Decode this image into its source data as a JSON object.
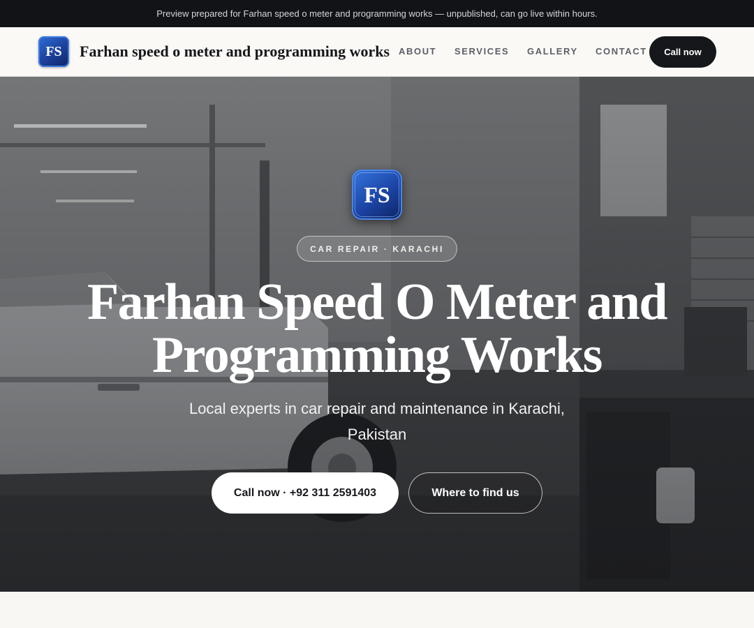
{
  "banner": {
    "text": "Preview prepared for Farhan speed o meter and programming works — unpublished, can go live within hours."
  },
  "header": {
    "logo_text": "FS",
    "brand_name": "Farhan speed o meter and programming works",
    "nav": [
      "ABOUT",
      "SERVICES",
      "GALLERY",
      "CONTACT"
    ],
    "cta_label": "Call now"
  },
  "hero": {
    "logo_text": "FS",
    "badge": "CAR REPAIR · KARACHI",
    "title_line1": "Farhan Speed O Meter and",
    "title_line2": "Programming Works",
    "subtitle": "Local experts in car repair and maintenance in Karachi, Pakistan",
    "primary_button": "Call now · +92 311 2591403",
    "secondary_button": "Where to find us"
  },
  "colors": {
    "dark": "#111317",
    "logo_blue": "#1b3f9a",
    "page_bg": "#f8f7f4"
  }
}
